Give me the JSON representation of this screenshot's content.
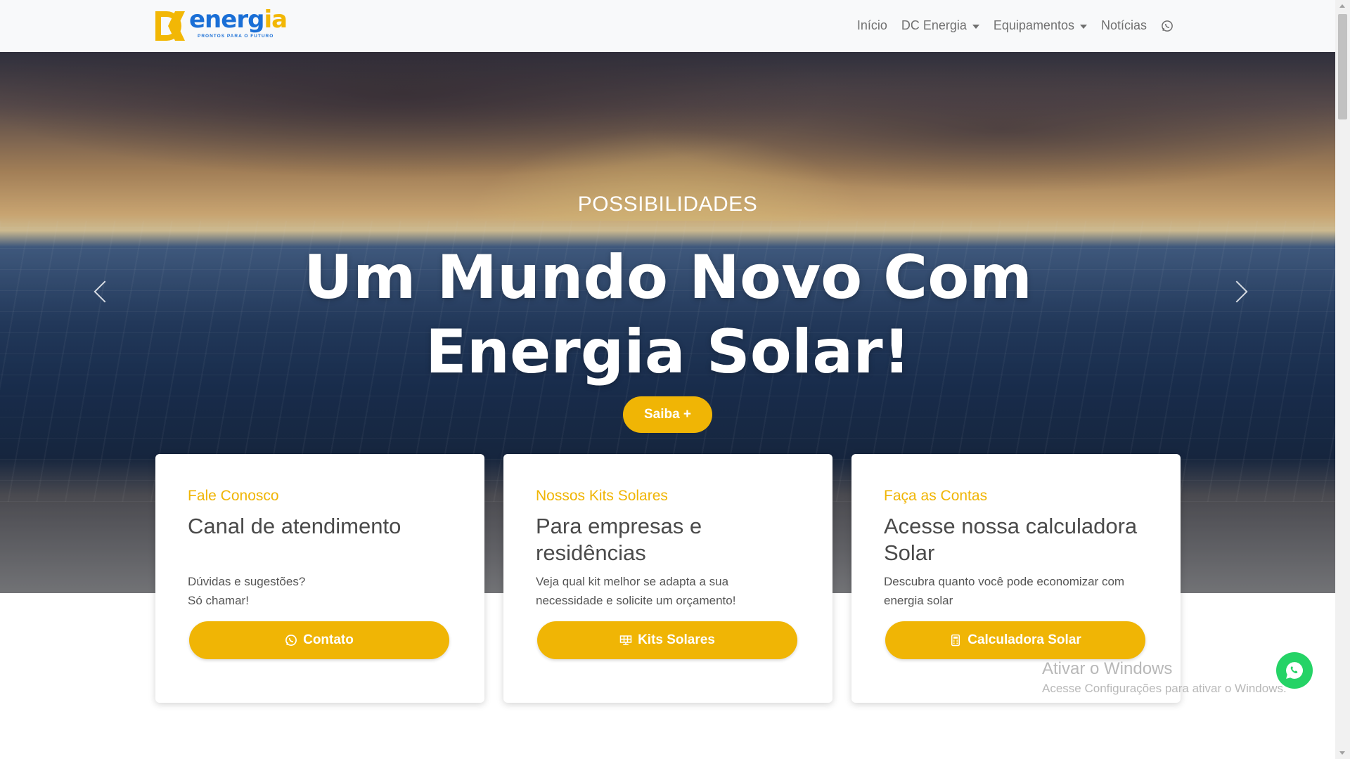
{
  "nav": {
    "logo_text_a": "energ",
    "logo_text_b": "ia",
    "logo_tagline": "PRONTOS PARA O FUTURO",
    "items": [
      {
        "label": "Início"
      },
      {
        "label": "DC Energia"
      },
      {
        "label": "Equipamentos"
      },
      {
        "label": "Notícias"
      }
    ]
  },
  "hero": {
    "eyebrow": "POSSIBILIDADES",
    "headline": "Um Mundo Novo Com Energia Solar!",
    "cta_label": "Saiba +"
  },
  "cards": [
    {
      "tag": "Fale Conosco",
      "title": "Canal de atendimento",
      "desc_line1": "Dúvidas e sugestões?",
      "desc_line2": "Só chamar!",
      "button": "Contato"
    },
    {
      "tag": "Nossos Kits Solares",
      "title": "Para empresas e residências",
      "desc_line1": "Veja qual kit melhor se adapta a sua",
      "desc_line2": "necessidade e solicite um orçamento!",
      "button": "Kits Solares"
    },
    {
      "tag": "Faça as Contas",
      "title": "Acesse nossa calculadora Solar",
      "desc_line1": "Descubra quanto você pode economizar com",
      "desc_line2": "energia solar",
      "button": "Calculadora Solar"
    }
  ],
  "watermark": {
    "title": "Ativar o Windows",
    "subtitle": "Acesse Configurações para ativar o Windows."
  },
  "colors": {
    "accent": "#f0b505",
    "brand_blue": "#1a6fd6",
    "whatsapp": "#25d366"
  }
}
